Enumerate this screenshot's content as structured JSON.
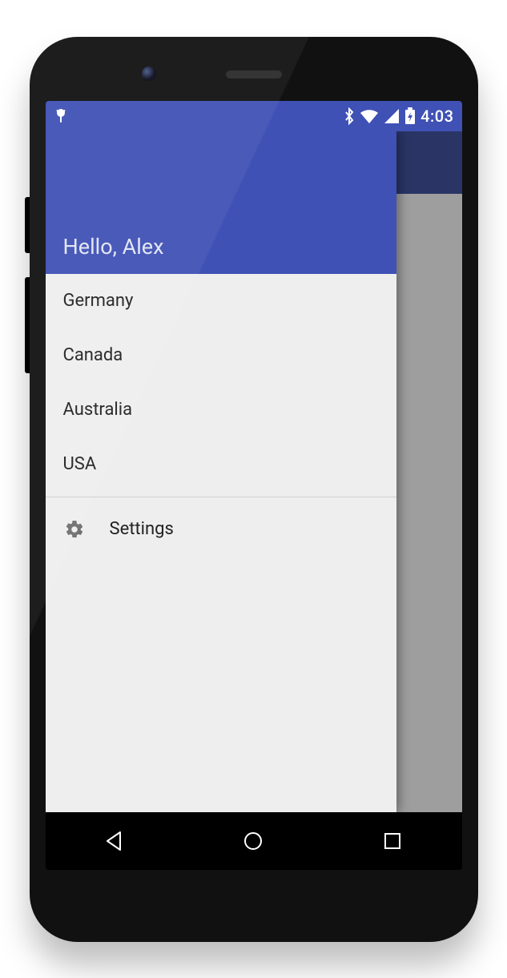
{
  "statusbar": {
    "time": "4:03"
  },
  "drawer": {
    "header_text": "Hello, Alex",
    "items": [
      {
        "label": "Germany"
      },
      {
        "label": "Canada"
      },
      {
        "label": "Australia"
      },
      {
        "label": "USA"
      }
    ],
    "settings_label": "Settings"
  },
  "colors": {
    "primary": "#3f51b5",
    "primary_dark": "#2a3566",
    "drawer_bg": "#eeeeee",
    "scrim": "#9e9e9e"
  }
}
